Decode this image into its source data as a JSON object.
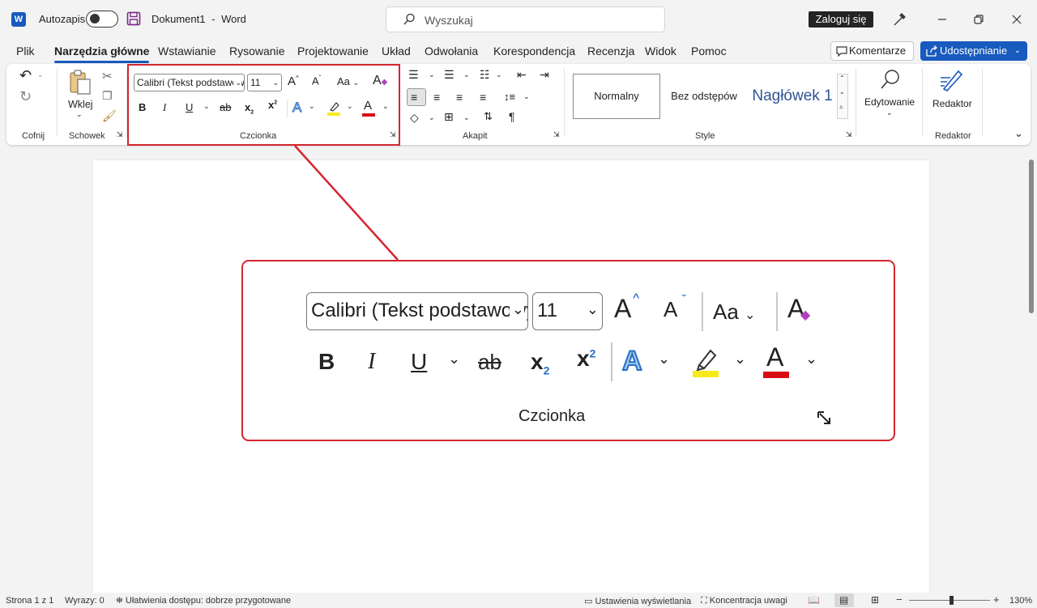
{
  "titlebar": {
    "autosave_label": "Autozapis",
    "document_name": "Dokument1",
    "separator": "-",
    "app_name": "Word",
    "search_placeholder": "Wyszukaj",
    "signin_label": "Zaloguj się",
    "logo_letter": "W"
  },
  "menu": {
    "tabs": [
      "Plik",
      "Narzędzia główne",
      "Wstawianie",
      "Rysowanie",
      "Projektowanie",
      "Układ",
      "Odwołania",
      "Korespondencja",
      "Recenzja",
      "Widok",
      "Pomoc"
    ],
    "active_tab": "Narzędzia główne",
    "comments_label": "Komentarze",
    "share_label": "Udostępnianie"
  },
  "ribbon": {
    "undo_group": "Cofnij",
    "clipboard_group": "Schowek",
    "paste_label": "Wklej",
    "font_group": "Czcionka",
    "font_name": "Calibri (Tekst podstawowy)",
    "font_size": "11",
    "change_case_label": "Aa",
    "paragraph_group": "Akapit",
    "styles_group": "Style",
    "styles": [
      "Normalny",
      "Bez odstępów",
      "Nagłówek 1"
    ],
    "editing_label": "Edytowanie",
    "editor_label": "Redaktor",
    "editor_group": "Redaktor"
  },
  "glyphs": {
    "bold": "B",
    "italic": "I",
    "underline": "U",
    "strike": "ab",
    "subscript_base": "x",
    "subscript_index": "2",
    "superscript_base": "x",
    "superscript_index": "2",
    "grow": "A",
    "shrink": "A",
    "text_effects": "A",
    "font_color": "A",
    "clear_formatting": "A",
    "pilcrow": "¶"
  },
  "callout": {
    "font_name": "Calibri (Tekst podstawowy)",
    "font_size": "11",
    "change_case_label": "Aa",
    "group_label": "Czcionka"
  },
  "statusbar": {
    "page_info": "Strona 1 z 1",
    "word_count": "Wyrazy: 0",
    "accessibility": "Ułatwienia dostępu: dobrze przygotowane",
    "display_settings": "Ustawienia wyświetlania",
    "focus": "Koncentracja uwagi",
    "zoom": "130%"
  },
  "colors": {
    "accent": "#185abd",
    "callout_border": "#d42630",
    "highlight_yellow": "#f7ea1a",
    "font_red": "#d80d14",
    "text_effect_blue": "#4a90d9"
  }
}
